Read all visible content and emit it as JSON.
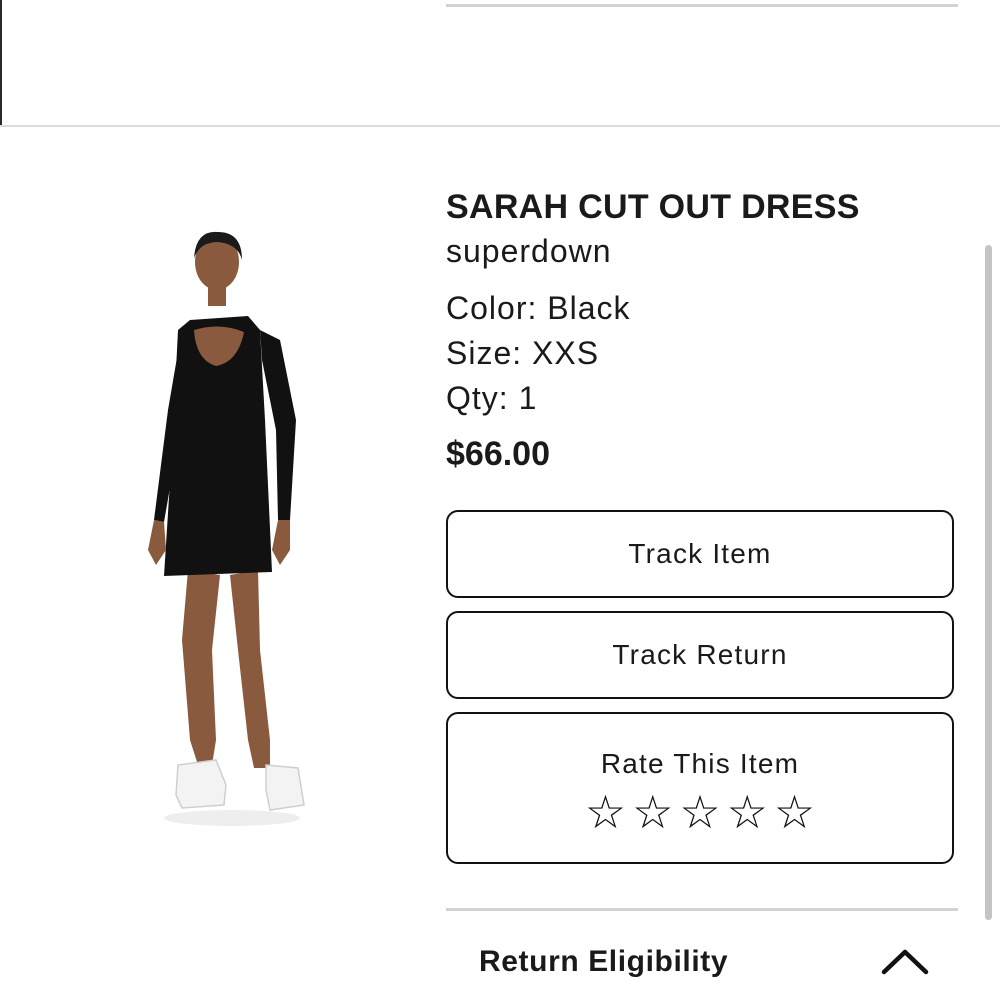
{
  "product": {
    "title": "SARAH CUT OUT DRESS",
    "brand": "superdown",
    "color": "Color: Black",
    "size": "Size: XXS",
    "qty": "Qty: 1",
    "price": "$66.00",
    "image_icon": "product-photo"
  },
  "actions": {
    "track_item": "Track Item",
    "track_return": "Track Return"
  },
  "rating": {
    "label": "Rate This Item",
    "max_stars": 5,
    "value": 0,
    "star_glyph": "☆"
  },
  "return_section": {
    "title": "Return Eligibility",
    "expanded": true,
    "toggle_icon": "chevron-up-icon"
  },
  "colors": {
    "text": "#1a1a1a",
    "border": "#111111",
    "divider": "#d2d2d2"
  }
}
